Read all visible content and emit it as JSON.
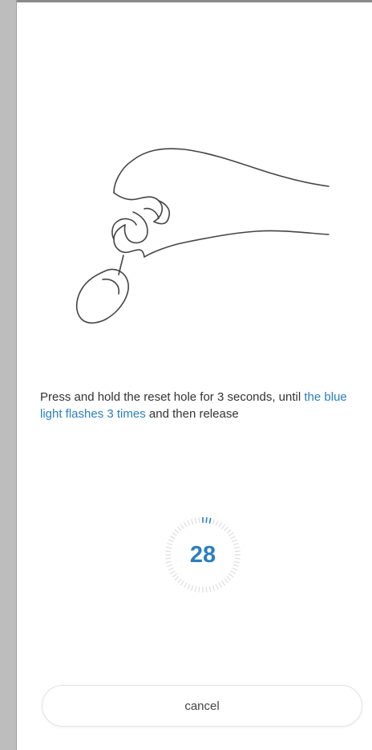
{
  "instruction": {
    "text_before": "Press and hold the reset hole for 3 seconds, until",
    "text_highlight": "the blue light flashes 3 times",
    "text_after": " and then release"
  },
  "timer": {
    "value": "28"
  },
  "cancel_button": {
    "label": "cancel"
  },
  "colors": {
    "accent": "#2a7fbf",
    "text": "#333333"
  },
  "icons": {
    "illustration": "hand-pressing-reset-illustration",
    "timer_ring": "countdown-ring-icon"
  }
}
